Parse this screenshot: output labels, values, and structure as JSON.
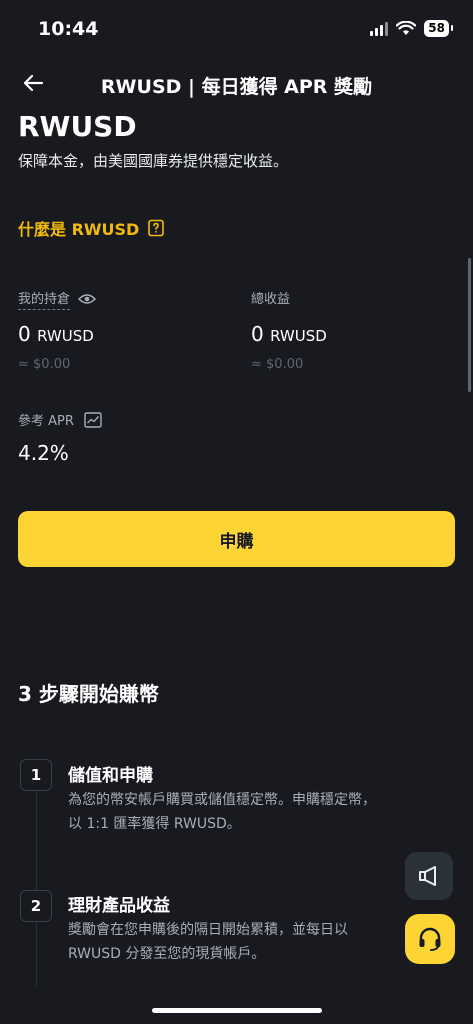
{
  "status_bar": {
    "time": "10:44",
    "battery": "58"
  },
  "header": {
    "title": "RWUSD | 每日獲得 APR 獎勵"
  },
  "hero": {
    "title": "RWUSD",
    "subtitle": "保障本金，由美國國庫券提供穩定收益。"
  },
  "what_is": {
    "label": "什麼是 RWUSD"
  },
  "holdings": {
    "label": "我的持倉",
    "amount": "0",
    "unit": "RWUSD",
    "usd": "≈ $0.00"
  },
  "earnings": {
    "label": "總收益",
    "amount": "0",
    "unit": "RWUSD",
    "usd": "≈ $0.00"
  },
  "apr": {
    "label": "參考 APR",
    "value": "4.2%"
  },
  "subscribe_button": {
    "label": "申購"
  },
  "steps": {
    "title": "3 步驟開始賺幣",
    "items": [
      {
        "num": "1",
        "title": "儲值和申購",
        "desc_1": "為您的幣安帳戶購買或儲值穩定幣。申購穩定幣，",
        "desc_2": "以 1:1 匯率獲得 RWUSD。"
      },
      {
        "num": "2",
        "title": "理財產品收益",
        "desc_1": "獎勵會在您申購後的隔日開始累積，並每日以",
        "desc_2": "RWUSD 分發至您的現貨帳戶。"
      }
    ]
  },
  "icons": {
    "back": "arrow-left-icon",
    "help": "question-box-icon",
    "eye": "eye-icon",
    "chart": "chart-line-icon",
    "announce": "megaphone-icon",
    "support": "headset-icon"
  },
  "colors": {
    "background": "#181a20",
    "accent": "#fcd535",
    "link": "#f0b90b"
  }
}
